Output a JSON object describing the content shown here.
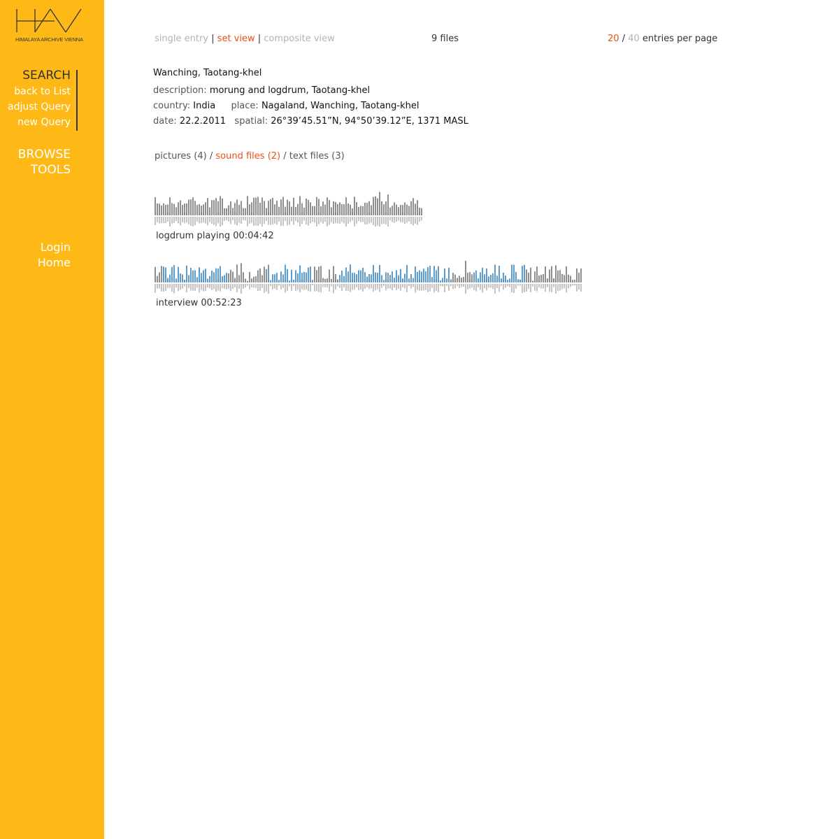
{
  "logo": {
    "letters": "HAV",
    "tagline": "HIMALAYA ARCHIVE VIENNA"
  },
  "sidebar": {
    "search_heading": "SEARCH",
    "search_items": [
      "back to List",
      "adjust Query",
      "new Query"
    ],
    "browse": "BROWSE",
    "tools": "TOOLS",
    "login": "Login",
    "home": "Home"
  },
  "topbar": {
    "single_entry": "single entry",
    "set_view": "set view",
    "composite_view": "composite view",
    "separator": "|",
    "files_count": "9 files",
    "per_page_20": "20",
    "per_page_slash": "/",
    "per_page_40": "40",
    "per_page_suffix": "entries per page"
  },
  "record": {
    "title": "Wanching, Taotang-khel",
    "description_label": "description:",
    "description": "morung and logdrum, Taotang-khel",
    "country_label": "country:",
    "country": "India",
    "place_label": "place:",
    "place": "Nagaland, Wanching, Taotang-khel",
    "date_label": "date:",
    "date": "22.2.2011",
    "spatial_label": "spatial:",
    "spatial": "26°39’45.51”N, 94°50’39.12”E, 1371 MASL"
  },
  "file_tabs": {
    "pictures": "pictures (4)",
    "sound": "sound files (2)",
    "text": "text files (3)",
    "slash": "/"
  },
  "sounds": [
    {
      "caption": "logdrum playing 00:04:42"
    },
    {
      "caption": "interview 00:52:23"
    }
  ],
  "colors": {
    "sidebar": "#FFB916",
    "accent": "#E8501A",
    "muted": "#b3b3b3",
    "waveform_gray": "#8e8e8e",
    "waveform_blue": "#5b9bd0",
    "waveform_reflection": "#c4c4c4"
  }
}
